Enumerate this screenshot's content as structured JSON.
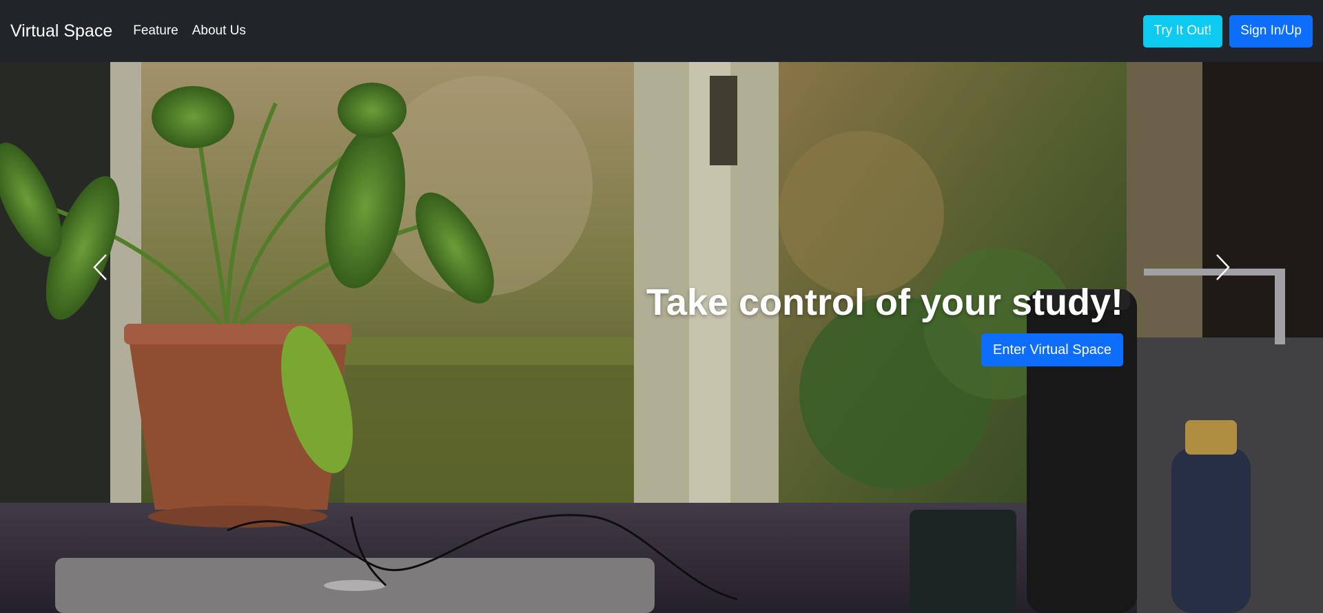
{
  "navbar": {
    "brand": "Virtual Space",
    "links": [
      "Feature",
      "About Us"
    ],
    "try_button": "Try It Out!",
    "signin_button": "Sign In/Up"
  },
  "hero": {
    "title": "Take control of your study!",
    "button": "Enter Virtual Space"
  },
  "carousel": {
    "prev_icon": "chevron-left-icon",
    "next_icon": "chevron-right-icon"
  },
  "colors": {
    "navbar_bg": "#212529",
    "info": "#0dcaf0",
    "primary": "#0d6efd"
  }
}
